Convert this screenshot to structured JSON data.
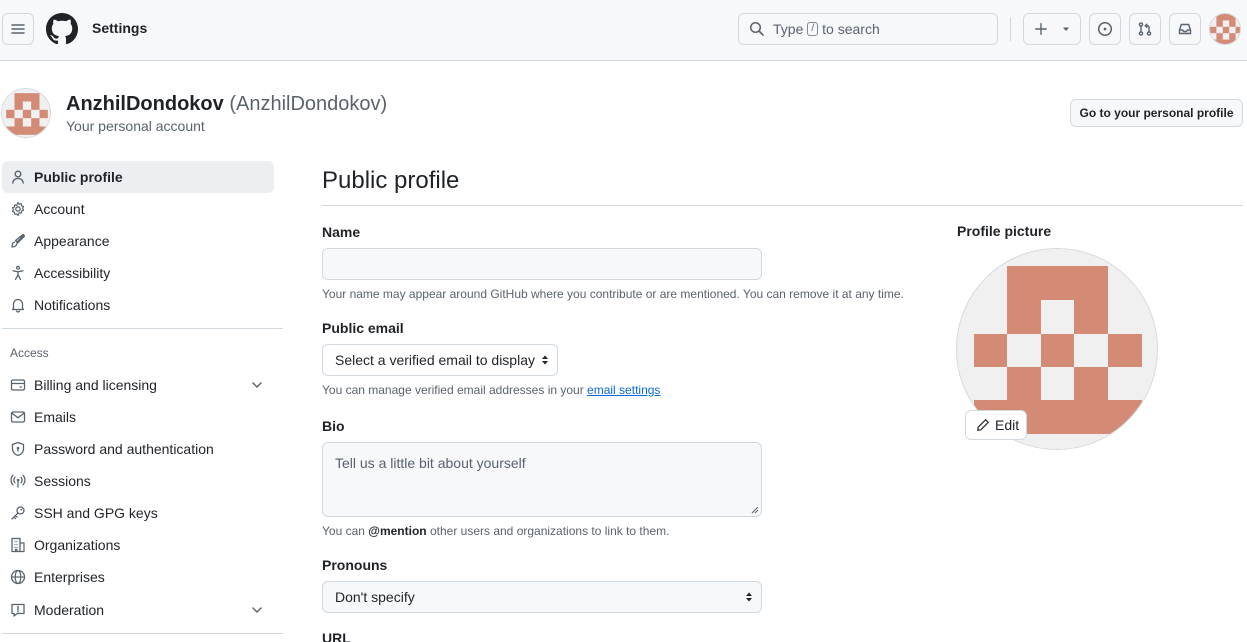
{
  "header": {
    "menu_icon": "hamburger-icon",
    "logo_icon": "github-logo-icon",
    "breadcrumb": "Settings",
    "search": {
      "before": "Type",
      "key": "/",
      "after": "to search"
    },
    "create_icon": "plus-icon",
    "issues_icon": "issue-opened-icon",
    "pulls_icon": "git-pull-request-icon",
    "inbox_icon": "inbox-icon"
  },
  "account": {
    "name": "AnzhilDondokov",
    "login": "(AnzhilDondokov)",
    "subtitle": "Your personal account",
    "go_profile_label": "Go to your personal profile"
  },
  "sidebar": {
    "items": [
      {
        "label": "Public profile",
        "icon": "person-icon",
        "active": true
      },
      {
        "label": "Account",
        "icon": "gear-icon"
      },
      {
        "label": "Appearance",
        "icon": "paintbrush-icon"
      },
      {
        "label": "Accessibility",
        "icon": "accessibility-icon"
      },
      {
        "label": "Notifications",
        "icon": "bell-icon"
      }
    ],
    "access_heading": "Access",
    "access_items": [
      {
        "label": "Billing and licensing",
        "icon": "credit-card-icon",
        "expandable": true
      },
      {
        "label": "Emails",
        "icon": "mail-icon"
      },
      {
        "label": "Password and authentication",
        "icon": "shield-lock-icon"
      },
      {
        "label": "Sessions",
        "icon": "broadcast-icon"
      },
      {
        "label": "SSH and GPG keys",
        "icon": "key-icon"
      },
      {
        "label": "Organizations",
        "icon": "organization-icon"
      },
      {
        "label": "Enterprises",
        "icon": "globe-icon"
      },
      {
        "label": "Moderation",
        "icon": "report-icon",
        "expandable": true
      }
    ]
  },
  "main": {
    "title": "Public profile",
    "name": {
      "label": "Name",
      "value": "",
      "note": "Your name may appear around GitHub where you contribute or are mentioned. You can remove it at any time."
    },
    "public_email": {
      "label": "Public email",
      "selected": "Select a verified email to display",
      "note_prefix": "You can manage verified email addresses in your ",
      "note_link": "email settings"
    },
    "bio": {
      "label": "Bio",
      "placeholder": "Tell us a little bit about yourself",
      "note_prefix": "You can ",
      "note_mention": "@mention",
      "note_suffix": " other users and organizations to link to them."
    },
    "pronouns": {
      "label": "Pronouns",
      "selected": "Don't specify"
    },
    "url": {
      "label": "URL"
    }
  },
  "profile_picture": {
    "label": "Profile picture",
    "edit_label": "Edit",
    "edit_icon": "pencil-icon",
    "identicon_color": "#d38b76",
    "identicon_bg": "#f0f0f0"
  },
  "colors": {
    "accent_link": "#0969da",
    "border": "#d1d9e0",
    "muted_text": "#59636e"
  }
}
